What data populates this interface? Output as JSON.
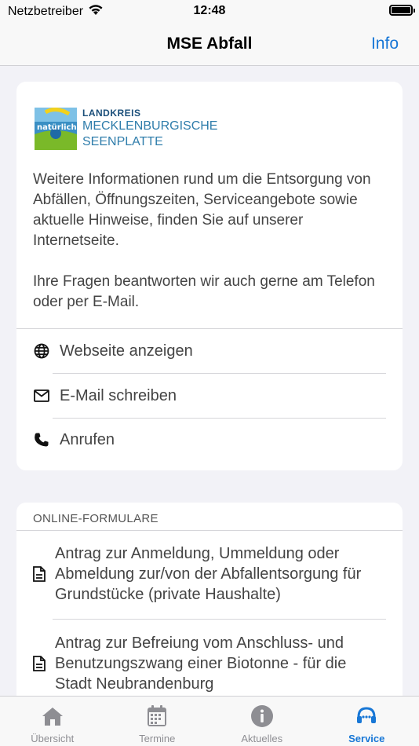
{
  "status_bar": {
    "carrier": "Netzbetreiber",
    "time": "12:48"
  },
  "nav": {
    "title": "MSE Abfall",
    "info_label": "Info"
  },
  "logo": {
    "badge_text": "natürlich!",
    "line1": "LANDKREIS",
    "line2": "MECKLENBURGISCHE",
    "line3": "SEENPLATTE"
  },
  "intro": {
    "paragraph1": "Weitere Informationen rund um die Entsorgung von Abfällen, Öffnungszeiten, Serviceangebote sowie aktuelle Hinweise, finden Sie auf unserer Internetseite.",
    "paragraph2": "Ihre Fragen beantworten wir auch gerne am Telefon oder per E-Mail."
  },
  "contact_actions": [
    {
      "label": "Webseite anzeigen",
      "icon": "globe-icon"
    },
    {
      "label": "E-Mail schreiben",
      "icon": "mail-icon"
    },
    {
      "label": "Anrufen",
      "icon": "phone-icon"
    }
  ],
  "forms": {
    "header": "ONLINE-FORMULARE",
    "items": [
      {
        "label": "Antrag zur Anmeldung, Ummeldung oder Abmeldung zur/von der Abfallentsorgung für Grundstücke (private Haushalte)",
        "icon": "document-icon"
      },
      {
        "label": "Antrag zur Befreiung vom Anschluss- und Benutzungszwang einer Biotonne - für die Stadt Neubrandenburg",
        "icon": "document-icon"
      }
    ]
  },
  "tabs": [
    {
      "label": "Übersicht",
      "icon": "home-icon",
      "active": false
    },
    {
      "label": "Termine",
      "icon": "calendar-icon",
      "active": false
    },
    {
      "label": "Aktuelles",
      "icon": "info-circle-icon",
      "active": false
    },
    {
      "label": "Service",
      "icon": "headset-icon",
      "active": true
    }
  ],
  "colors": {
    "accent": "#1877d6",
    "inactive_tab": "#8e8e93",
    "background": "#f2f2f7"
  }
}
